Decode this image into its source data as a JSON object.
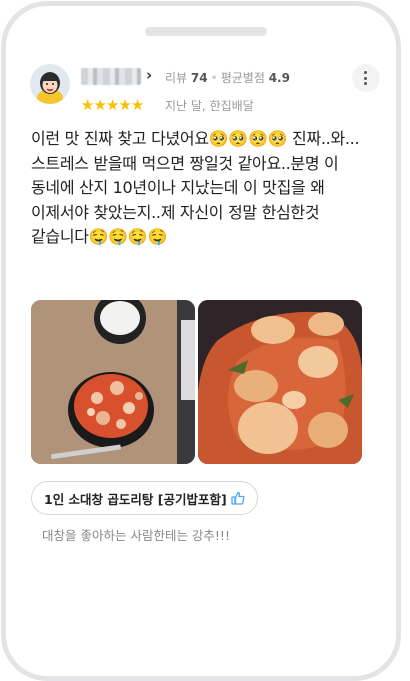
{
  "reviewer": {
    "stats_review_label": "리뷰",
    "stats_review_count": "74",
    "stats_avg_label": "평균별점",
    "stats_avg_value": "4.9",
    "rating": 5,
    "visit_info": "지난 달, 한집배달"
  },
  "review": {
    "text": "이런 맛 진짜 찾고 다녔어요🥺🥺🥺🥺 진짜..와... 스트레스 받을때 먹으면 짱일것 같아요..분명 이 동네에 산지 10년이나 지났는데 이 맛집을 왜 이제서야 찾았는지..제 자신이 정말 한심한것 같습니다🤤🤤🤤🤤"
  },
  "menu": {
    "item": "1인 소대창 곱도리탕 [공기밥포함]",
    "comment": "대창을 좋아하는 사람한테는 강추!!!"
  },
  "colors": {
    "star": "#f9c100",
    "thumb": "#4ba3f5",
    "muted": "#999999"
  }
}
